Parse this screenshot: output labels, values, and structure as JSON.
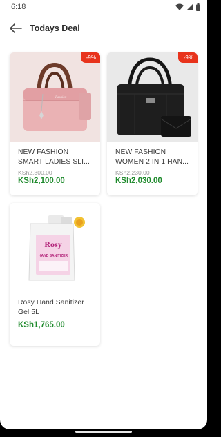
{
  "status": {
    "time": "6:18"
  },
  "header": {
    "title": "Todays Deal"
  },
  "products": [
    {
      "name_line1": "NEW FASHION",
      "name_line2": "SMART LADIES SLI...",
      "old_price": "KSh2,300.00",
      "price": "KSh2,100.00",
      "discount": "-9%"
    },
    {
      "name_line1": "NEW FASHION",
      "name_line2": "WOMEN 2 IN 1 HAN...",
      "old_price": "KSh2,230.00",
      "price": "KSh2,030.00",
      "discount": "-9%"
    },
    {
      "name_line1": "Rosy Hand Sanitizer",
      "name_line2": "Gel 5L",
      "price": "KSh1,765.00",
      "label_brand": "Rosy",
      "label_text": "HAND SANITIZER"
    }
  ],
  "colors": {
    "price": "#1e8a2c",
    "badge": "#e8331c"
  }
}
